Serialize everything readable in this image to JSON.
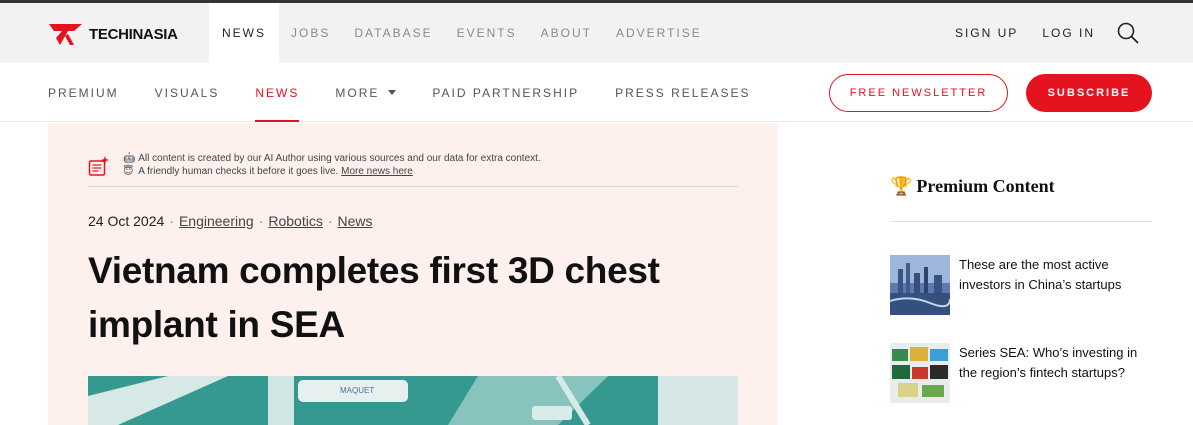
{
  "brand": {
    "logo_text": "TECHINASIA"
  },
  "topnav": {
    "items": [
      {
        "label": "NEWS"
      },
      {
        "label": "JOBS"
      },
      {
        "label": "DATABASE"
      },
      {
        "label": "EVENTS"
      },
      {
        "label": "ABOUT"
      },
      {
        "label": "ADVERTISE"
      }
    ],
    "signup": "SIGN UP",
    "login": "LOG IN"
  },
  "secnav": {
    "items": [
      {
        "label": "PREMIUM"
      },
      {
        "label": "VISUALS"
      },
      {
        "label": "NEWS"
      },
      {
        "label": "MORE"
      },
      {
        "label": "PAID PARTNERSHIP"
      },
      {
        "label": "PRESS RELEASES"
      }
    ],
    "newsletter_button": "FREE NEWSLETTER",
    "subscribe_button": "SUBSCRIBE"
  },
  "article": {
    "ai_notice_line1": "All content is created by our AI Author using various sources and our data for extra context.",
    "ai_notice_line2": "A friendly human checks it before it goes live.",
    "ai_notice_link": "More news here",
    "date": "24 Oct 2024",
    "tags": [
      "Engineering",
      "Robotics",
      "News"
    ],
    "headline": "Vietnam completes first 3D chest implant in SEA",
    "hero_text": "MAQUET"
  },
  "sidebar": {
    "title": "Premium Content",
    "items": [
      {
        "title": "These are the most active investors in China’s startups"
      },
      {
        "title": "Series SEA: Who’s investing in the region’s fintech startups?"
      }
    ]
  },
  "colors": {
    "accent": "#e5121f",
    "article_bg": "#fdf0ed",
    "topbar_bg": "#f2f2f2"
  }
}
